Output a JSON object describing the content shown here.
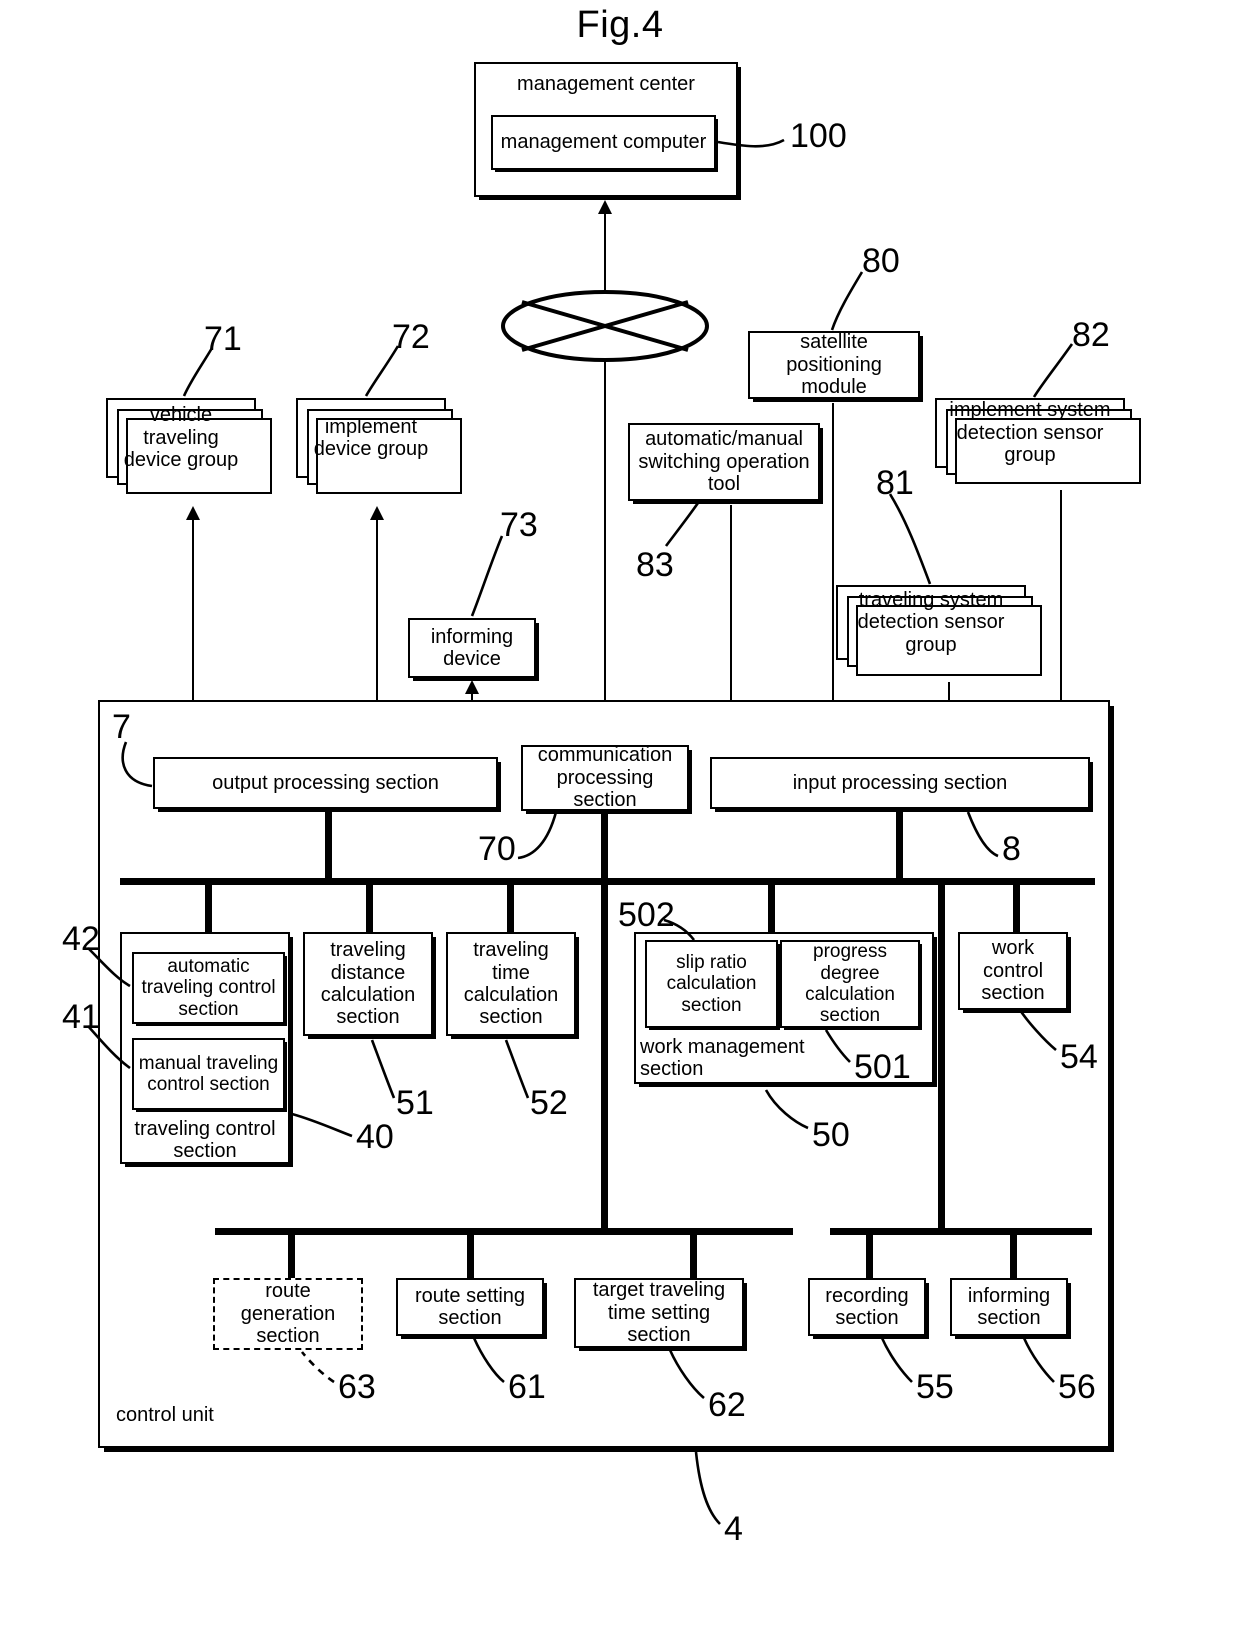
{
  "figure": {
    "title": "Fig.4",
    "caption": "control unit"
  },
  "nodes": {
    "management_center": "management center",
    "management_computer": "management computer",
    "vehicle_traveling_device_group": "vehicle traveling device group",
    "implement_device_group": "implement device group",
    "informing_device": "informing device",
    "satellite_positioning_module": "satellite positioning module",
    "automatic_manual_switching_operation_tool": "automatic/manual switching operation tool",
    "implement_system_detection_sensor_group": "implement system detection sensor group",
    "traveling_system_detection_sensor_group": "traveling system detection sensor group",
    "output_processing_section": "output processing section",
    "communication_processing_section": "communication processing section",
    "input_processing_section": "input processing section",
    "traveling_control_section": "traveling control section",
    "automatic_traveling_control_section": "automatic traveling control section",
    "manual_traveling_control_section": "manual traveling control section",
    "traveling_distance_calculation_section": "traveling distance calculation section",
    "traveling_time_calculation_section": "traveling time calculation section",
    "work_management_section": "work management section",
    "slip_ratio_calculation_section": "slip ratio calculation section",
    "progress_degree_calculation_section": "progress degree calculation section",
    "work_control_section": "work control section",
    "route_generation_section": "route generation section",
    "route_setting_section": "route setting section",
    "target_traveling_time_setting_section": "target traveling time setting section",
    "recording_section": "recording section",
    "informing_section": "informing section"
  },
  "refs": {
    "r100": "100",
    "r71": "71",
    "r72": "72",
    "r73": "73",
    "r80": "80",
    "r81": "81",
    "r82": "82",
    "r83": "83",
    "r7": "7",
    "r70": "70",
    "r8": "8",
    "r42": "42",
    "r41": "41",
    "r40": "40",
    "r51": "51",
    "r52": "52",
    "r502": "502",
    "r501": "501",
    "r50": "50",
    "r54": "54",
    "r63": "63",
    "r61": "61",
    "r62": "62",
    "r55": "55",
    "r56": "56",
    "r4": "4"
  },
  "colors": {
    "ink": "#000000",
    "paper": "#ffffff"
  }
}
